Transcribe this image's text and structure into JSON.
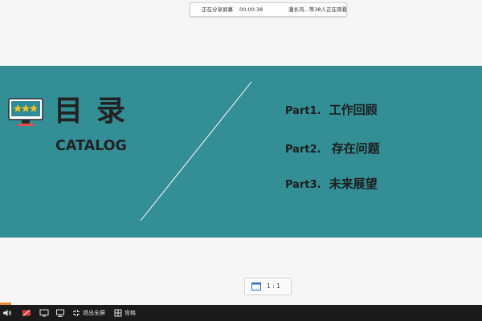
{
  "share_bar": {
    "status": "正在分享屏幕",
    "timer": "00:00:38",
    "viewers": "潘长鸿...等38人正在观看"
  },
  "slide": {
    "title": "目录",
    "subtitle": "CATALOG",
    "items": [
      {
        "part": "Part1.",
        "text": "工作回顾"
      },
      {
        "part": "Part2.",
        "text": "存在问题"
      },
      {
        "part": "Part3.",
        "text": "未来展望"
      }
    ],
    "colors": {
      "band": "#348e96",
      "text": "#222222",
      "line": "#ffffff"
    }
  },
  "ratio": {
    "label": "1 : 1"
  },
  "bottom_bar": {
    "exit_fullscreen": "退出全屏",
    "grid": "宫格"
  },
  "icons": [
    "volume-icon",
    "mic-muted-icon",
    "screen-icon",
    "camera-icon",
    "exit-fullscreen-icon",
    "grid-icon",
    "monitor-stars-icon",
    "aspect-ratio-icon"
  ]
}
